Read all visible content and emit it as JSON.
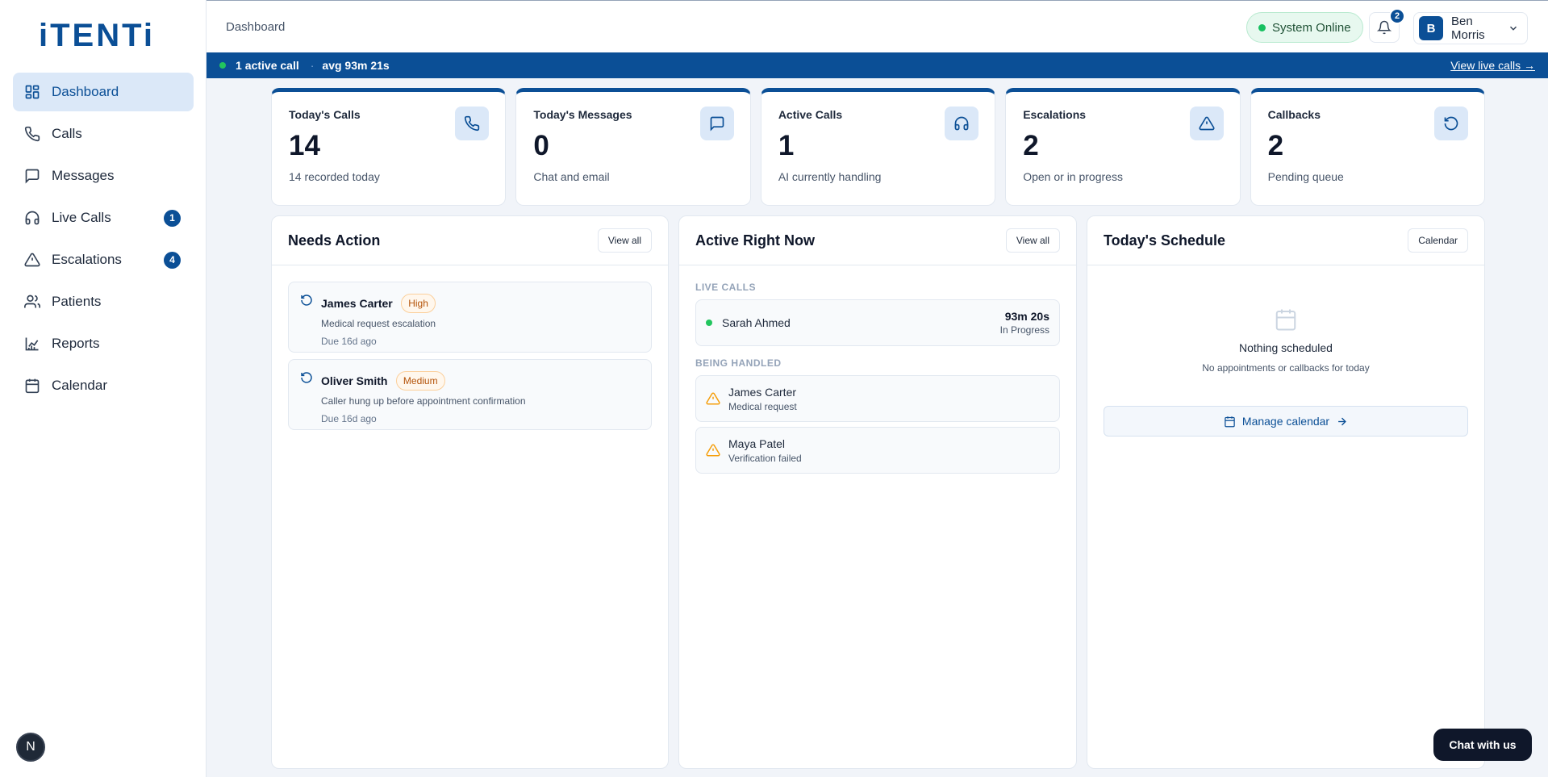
{
  "brand": {
    "logo": "iTENTi",
    "color": "#0b4f96"
  },
  "sidebar": {
    "items": [
      {
        "label": "Dashboard",
        "icon": "dashboard-icon",
        "active": true
      },
      {
        "label": "Calls",
        "icon": "phone-icon"
      },
      {
        "label": "Messages",
        "icon": "message-icon"
      },
      {
        "label": "Live Calls",
        "icon": "headphones-icon",
        "badge": "1"
      },
      {
        "label": "Escalations",
        "icon": "warning-icon",
        "badge": "4"
      },
      {
        "label": "Patients",
        "icon": "users-icon"
      },
      {
        "label": "Reports",
        "icon": "chart-icon"
      },
      {
        "label": "Calendar",
        "icon": "calendar-icon"
      }
    ],
    "footer_avatar": "N"
  },
  "header": {
    "breadcrumb": "Dashboard",
    "status": "System Online",
    "notification_count": "2",
    "user": {
      "initial": "B",
      "name": "Ben Morris"
    }
  },
  "strip": {
    "count": "1",
    "count_label": "active call",
    "separator": "·",
    "avg": "avg 93m 21s",
    "link": "View live calls →"
  },
  "stats": [
    {
      "title": "Today's Calls",
      "value": "14",
      "sub": "14 recorded today",
      "icon": "phone-icon"
    },
    {
      "title": "Today's Messages",
      "value": "0",
      "sub": "Chat and email",
      "icon": "message-icon"
    },
    {
      "title": "Active Calls",
      "value": "1",
      "sub": "AI currently handling",
      "icon": "headphones-icon"
    },
    {
      "title": "Escalations",
      "value": "2",
      "sub": "Open or in progress",
      "icon": "warning-icon"
    },
    {
      "title": "Callbacks",
      "value": "2",
      "sub": "Pending queue",
      "icon": "refresh-icon"
    }
  ],
  "needs_action": {
    "title": "Needs Action",
    "button": "View all",
    "items": [
      {
        "name": "James Carter",
        "priority": "High",
        "desc": "Medical request escalation",
        "due": "Due 16d ago"
      },
      {
        "name": "Oliver Smith",
        "priority": "Medium",
        "desc": "Caller hung up before appointment confirmation",
        "due": "Due 16d ago"
      }
    ]
  },
  "active_now": {
    "title": "Active Right Now",
    "button": "View all",
    "live_label": "LIVE CALLS",
    "live": [
      {
        "name": "Sarah Ahmed",
        "time": "93m 20s",
        "status": "In Progress"
      }
    ],
    "handled_label": "BEING HANDLED",
    "handled": [
      {
        "name": "James Carter",
        "desc": "Medical request"
      },
      {
        "name": "Maya Patel",
        "desc": "Verification failed"
      }
    ]
  },
  "schedule": {
    "title": "Today's Schedule",
    "button": "Calendar",
    "empty_title": "Nothing scheduled",
    "empty_desc": "No appointments or callbacks for today",
    "manage": "Manage calendar"
  },
  "chat": {
    "label": "Chat with us"
  }
}
